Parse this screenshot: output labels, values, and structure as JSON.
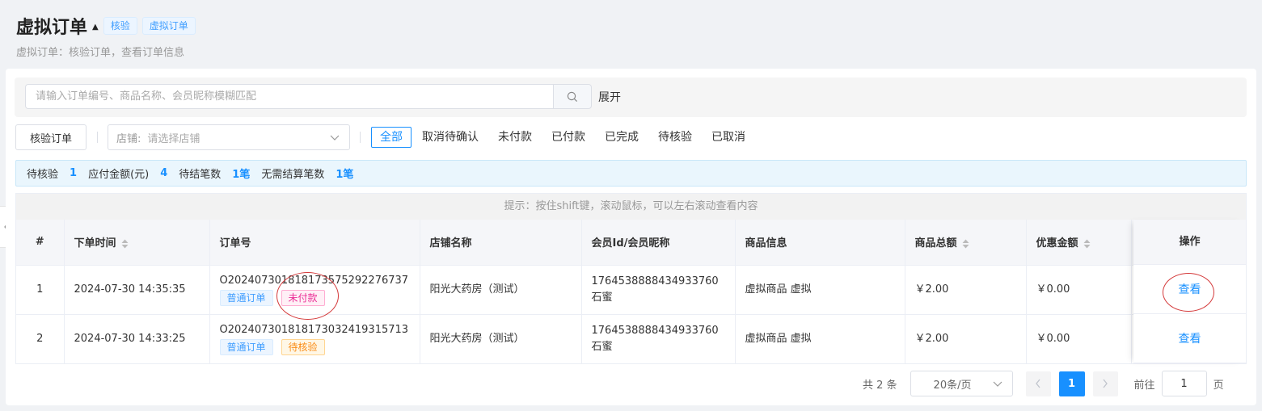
{
  "header": {
    "title": "虚拟订单",
    "tags": [
      "核验",
      "虚拟订单"
    ],
    "subtitle": "虚拟订单：核验订单，查看订单信息"
  },
  "search": {
    "placeholder": "请输入订单编号、商品名称、会员昵称模糊匹配",
    "value": "",
    "expand_label": "展开"
  },
  "toolbar": {
    "verify_button": "核验订单",
    "store_prefix": "店铺:",
    "store_placeholder": "请选择店铺",
    "filters": [
      "全部",
      "取消待确认",
      "未付款",
      "已付款",
      "已完成",
      "待核验",
      "已取消"
    ],
    "active_filter": "全部"
  },
  "stats": [
    {
      "label": "待核验",
      "value": "1"
    },
    {
      "label": "应付金额(元)",
      "value": "4"
    },
    {
      "label": "待结笔数",
      "value": "1笔"
    },
    {
      "label": "无需结算笔数",
      "value": "1笔"
    }
  ],
  "table": {
    "hint": "提示：按住shift键，滚动鼠标，可以左右滚动查看内容",
    "columns": [
      "#",
      "下单时间",
      "订单号",
      "店铺名称",
      "会员Id/会员昵称",
      "商品信息",
      "商品总额",
      "优惠金额",
      "操作"
    ],
    "rows": [
      {
        "index": "1",
        "time": "2024-07-30 14:35:35",
        "order_no": "O20240730181817357529227​6737",
        "tags": [
          "普通订单",
          "未付款"
        ],
        "store": "阳光大药房（测试）",
        "member_id": "1764538888434933760",
        "member_name": "石蜜",
        "goods": "虚拟商品 虚拟",
        "total": "￥2.00",
        "discount": "￥0.00",
        "action": "查看"
      },
      {
        "index": "2",
        "time": "2024-07-30 14:33:25",
        "order_no": "O20240730181817303241931​5713",
        "tags": [
          "普通订单",
          "待核验"
        ],
        "store": "阳光大药房（测试）",
        "member_id": "1764538888434933760",
        "member_name": "石蜜",
        "goods": "虚拟商品 虚拟",
        "total": "￥2.00",
        "discount": "￥0.00",
        "action": "查看"
      }
    ]
  },
  "pagination": {
    "total_text": "共 2 条",
    "page_size": "20条/页",
    "current_page": "1",
    "goto_label": "前往",
    "goto_value": "1",
    "page_unit": "页"
  },
  "colors": {
    "primary": "#1890ff",
    "tag_blue": "#409eff",
    "tag_pink": "#eb2f96",
    "tag_orange": "#fa8c16",
    "annotation_red": "#d4393a"
  }
}
